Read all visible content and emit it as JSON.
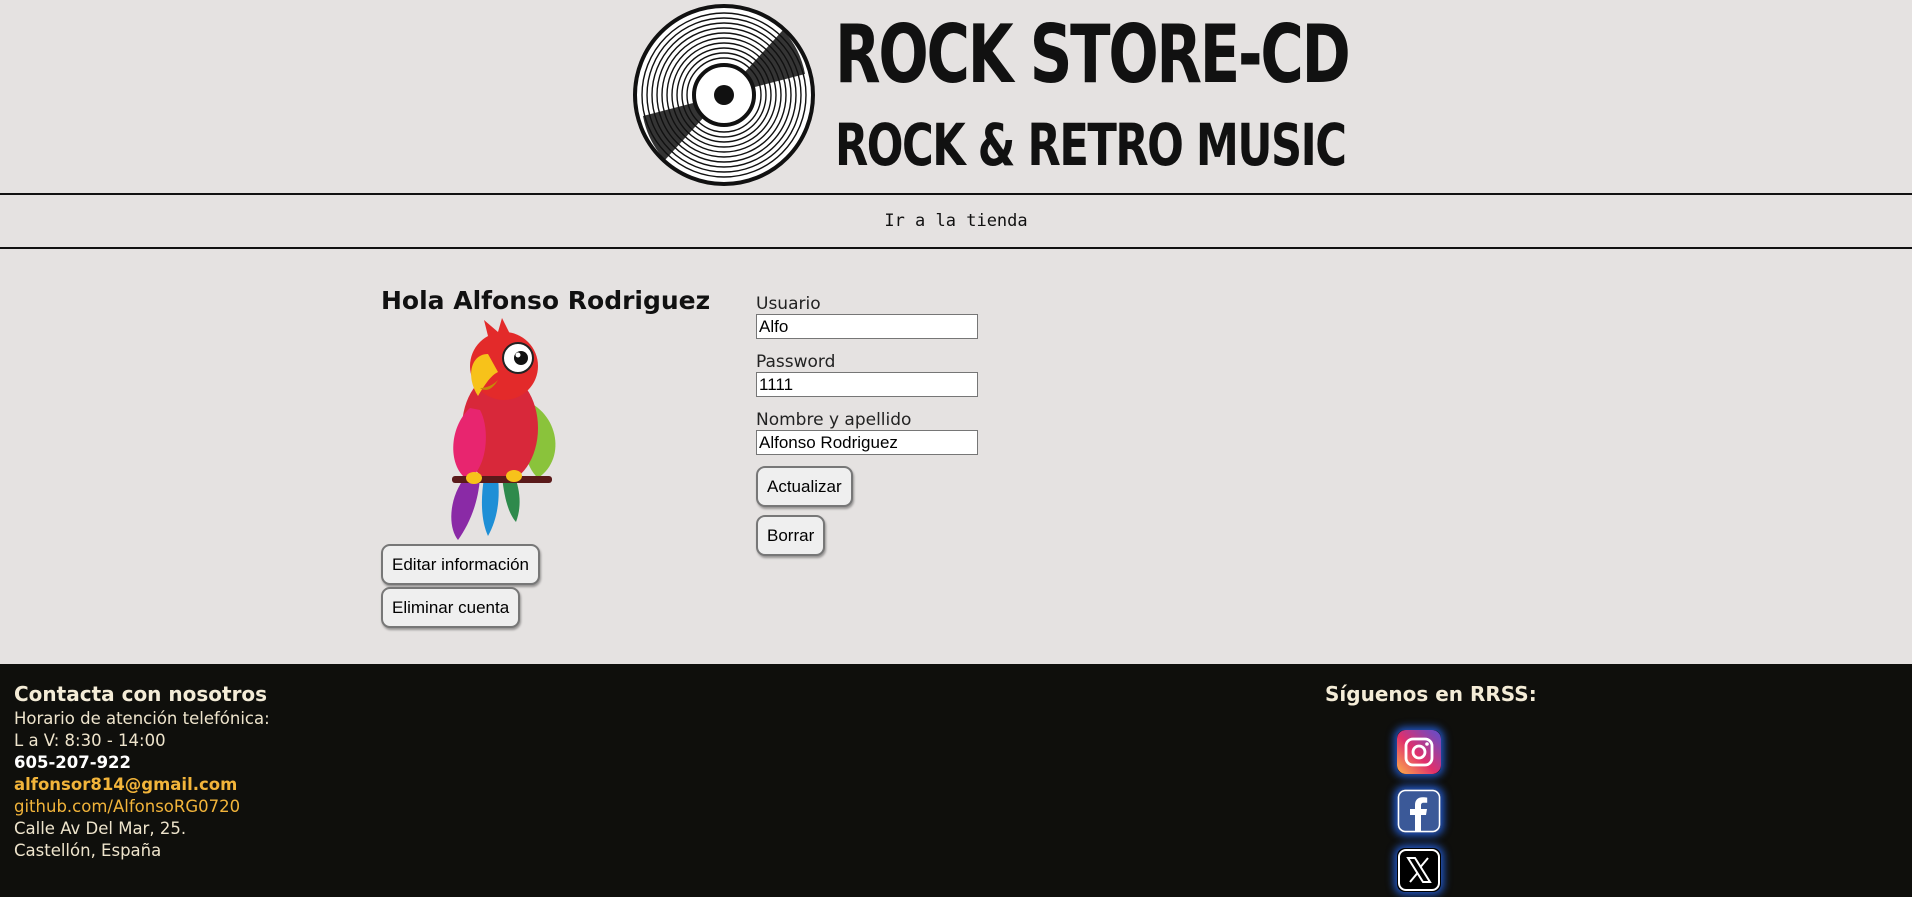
{
  "header": {
    "logo_title": "ROCK STORE-CD",
    "logo_subtitle": "ROCK & RETRO MUSIC",
    "logo_icon": "vinyl-record-icon"
  },
  "nav": {
    "store_link": "Ir a la tienda"
  },
  "profile": {
    "greeting": "Hola Alfonso Rodriguez",
    "avatar_icon": "parrot-avatar",
    "edit_button": "Editar información",
    "delete_button": "Eliminar cuenta"
  },
  "form": {
    "user_label": "Usuario",
    "user_value": "Alfo",
    "password_label": "Password",
    "password_value": "1111",
    "name_label": "Nombre y apellido",
    "name_value": "Alfonso Rodriguez",
    "update_button": "Actualizar",
    "clear_button": "Borrar"
  },
  "footer": {
    "contact_title": "Contacta con nosotros",
    "hours_label": "Horario de atención telefónica:",
    "hours": "L a V: 8:30 - 14:00",
    "phone": "605-207-922",
    "email": "alfonsor814@gmail.com",
    "github": "github.com/AlfonsoRG0720",
    "address": "Calle Av Del Mar, 25.",
    "city": "Castellón, España",
    "social_title": "Síguenos en RRSS:",
    "social_icons": [
      "instagram-icon",
      "facebook-icon",
      "x-icon"
    ]
  },
  "colors": {
    "background": "#e5e2e1",
    "footer_bg": "#0f0f0c",
    "accent": "#f2b43a",
    "social_glow": "#286eff"
  }
}
